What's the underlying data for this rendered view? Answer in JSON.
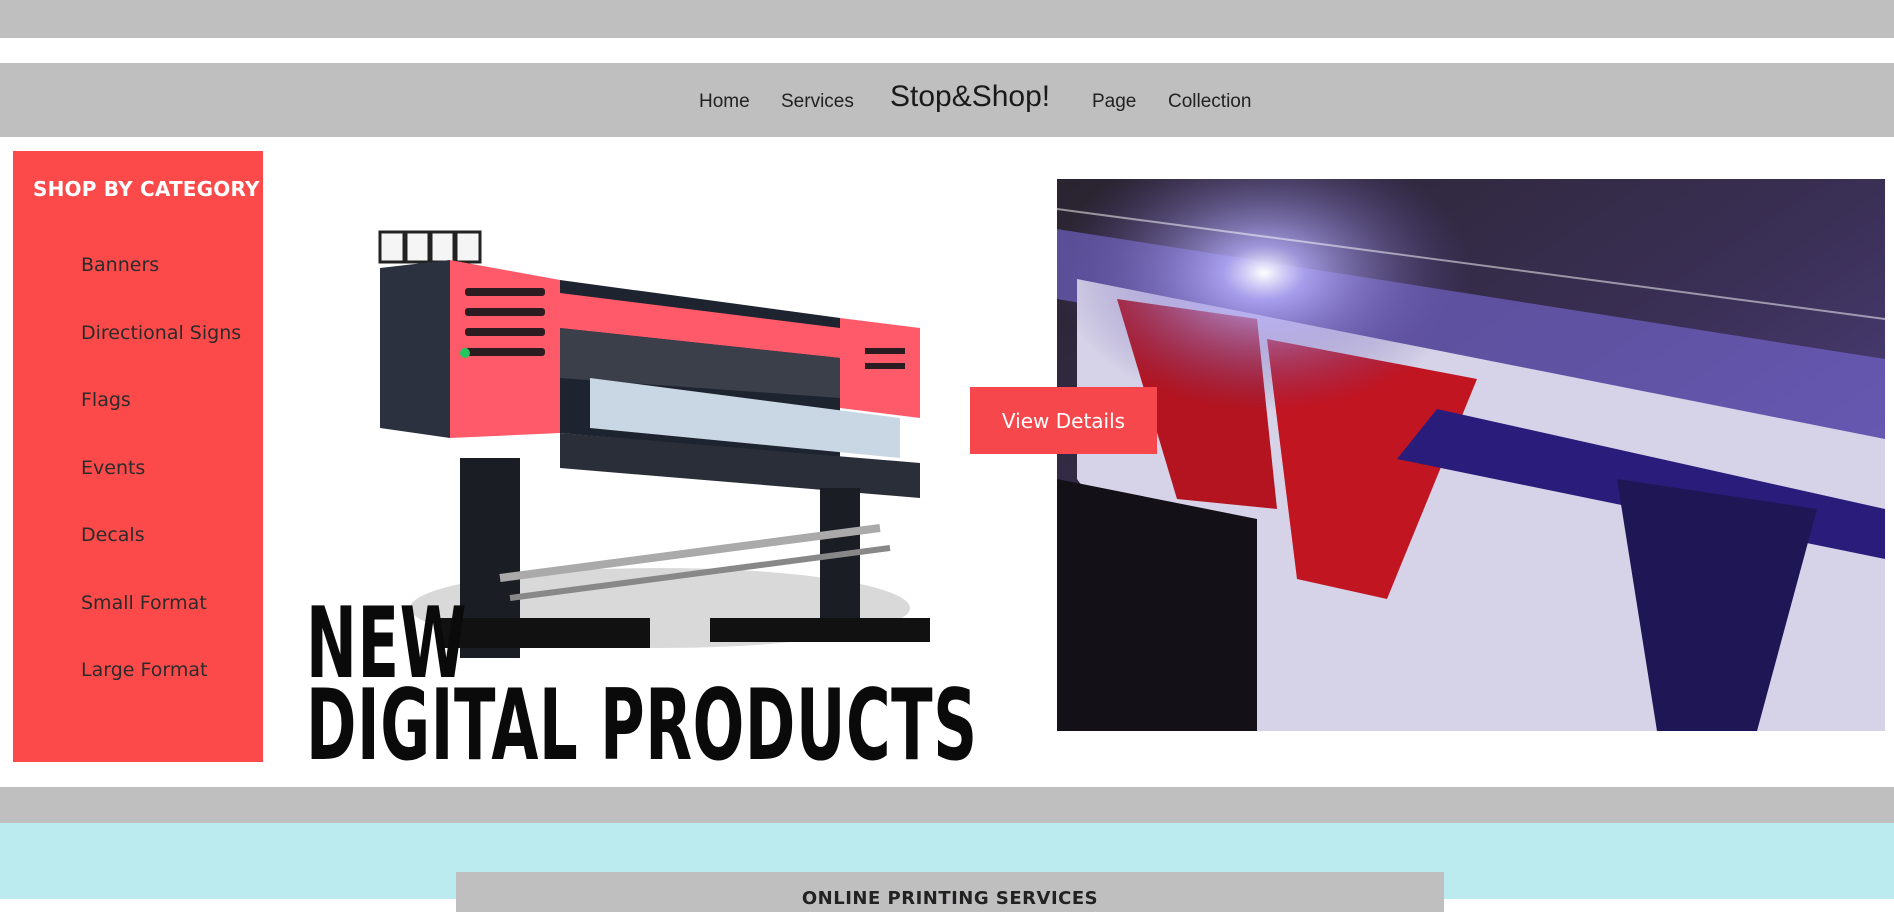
{
  "nav": {
    "home": "Home",
    "services": "Services",
    "brand": "Stop&Shop!",
    "page": "Page",
    "collection": "Collection"
  },
  "sidebar": {
    "title": "SHOP BY CATEGORY",
    "items": [
      {
        "label": "Banners"
      },
      {
        "label": "Directional Signs"
      },
      {
        "label": "Flags"
      },
      {
        "label": "Events"
      },
      {
        "label": "Decals"
      },
      {
        "label": "Small Format"
      },
      {
        "label": "Large Format"
      }
    ]
  },
  "hero": {
    "line1": "NEW",
    "line2": "DIGITAL PRODUCTS",
    "button_label": "View Details"
  },
  "section": {
    "title": "ONLINE PRINTING SERVICES"
  },
  "colors": {
    "accent": "#fc4a4a",
    "gray_bar": "#c0bfc0",
    "cyan_band": "#bbebef"
  }
}
